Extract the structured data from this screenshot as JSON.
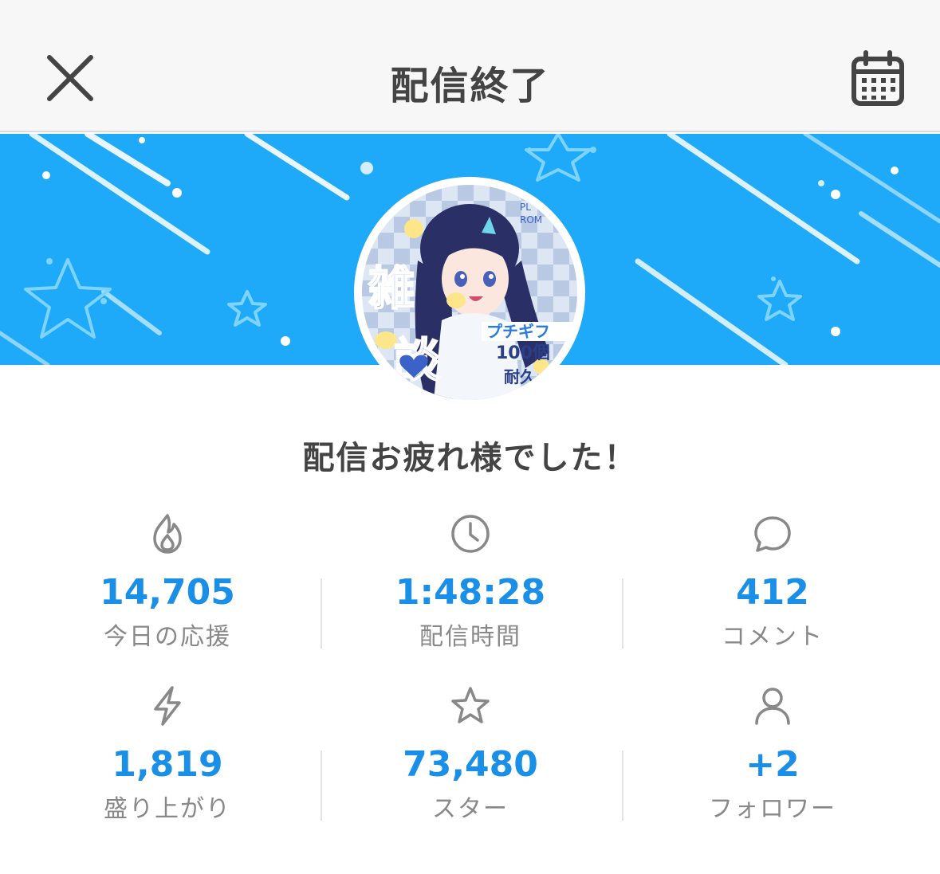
{
  "header": {
    "title": "配信終了",
    "close_icon": "close-icon",
    "calendar_icon": "calendar-icon"
  },
  "avatar": {
    "thumbnail_texts": [
      "雑談",
      "プチギフ",
      "100個",
      "耐久"
    ]
  },
  "message": "配信お疲れ様でした！",
  "colors": {
    "banner": "#1eaaf9",
    "value": "#1a8fe8",
    "label": "#888888",
    "header_bg": "#f7f7f7"
  },
  "stats": [
    {
      "icon": "flame-icon",
      "value": "14,705",
      "label": "今日の応援"
    },
    {
      "icon": "clock-icon",
      "value": "1:48:28",
      "label": "配信時間"
    },
    {
      "icon": "comment-icon",
      "value": "412",
      "label": "コメント"
    },
    {
      "icon": "lightning-icon",
      "value": "1,819",
      "label": "盛り上がり"
    },
    {
      "icon": "star-icon",
      "value": "73,480",
      "label": "スター"
    },
    {
      "icon": "user-icon",
      "value": "+2",
      "label": "フォロワー"
    }
  ]
}
